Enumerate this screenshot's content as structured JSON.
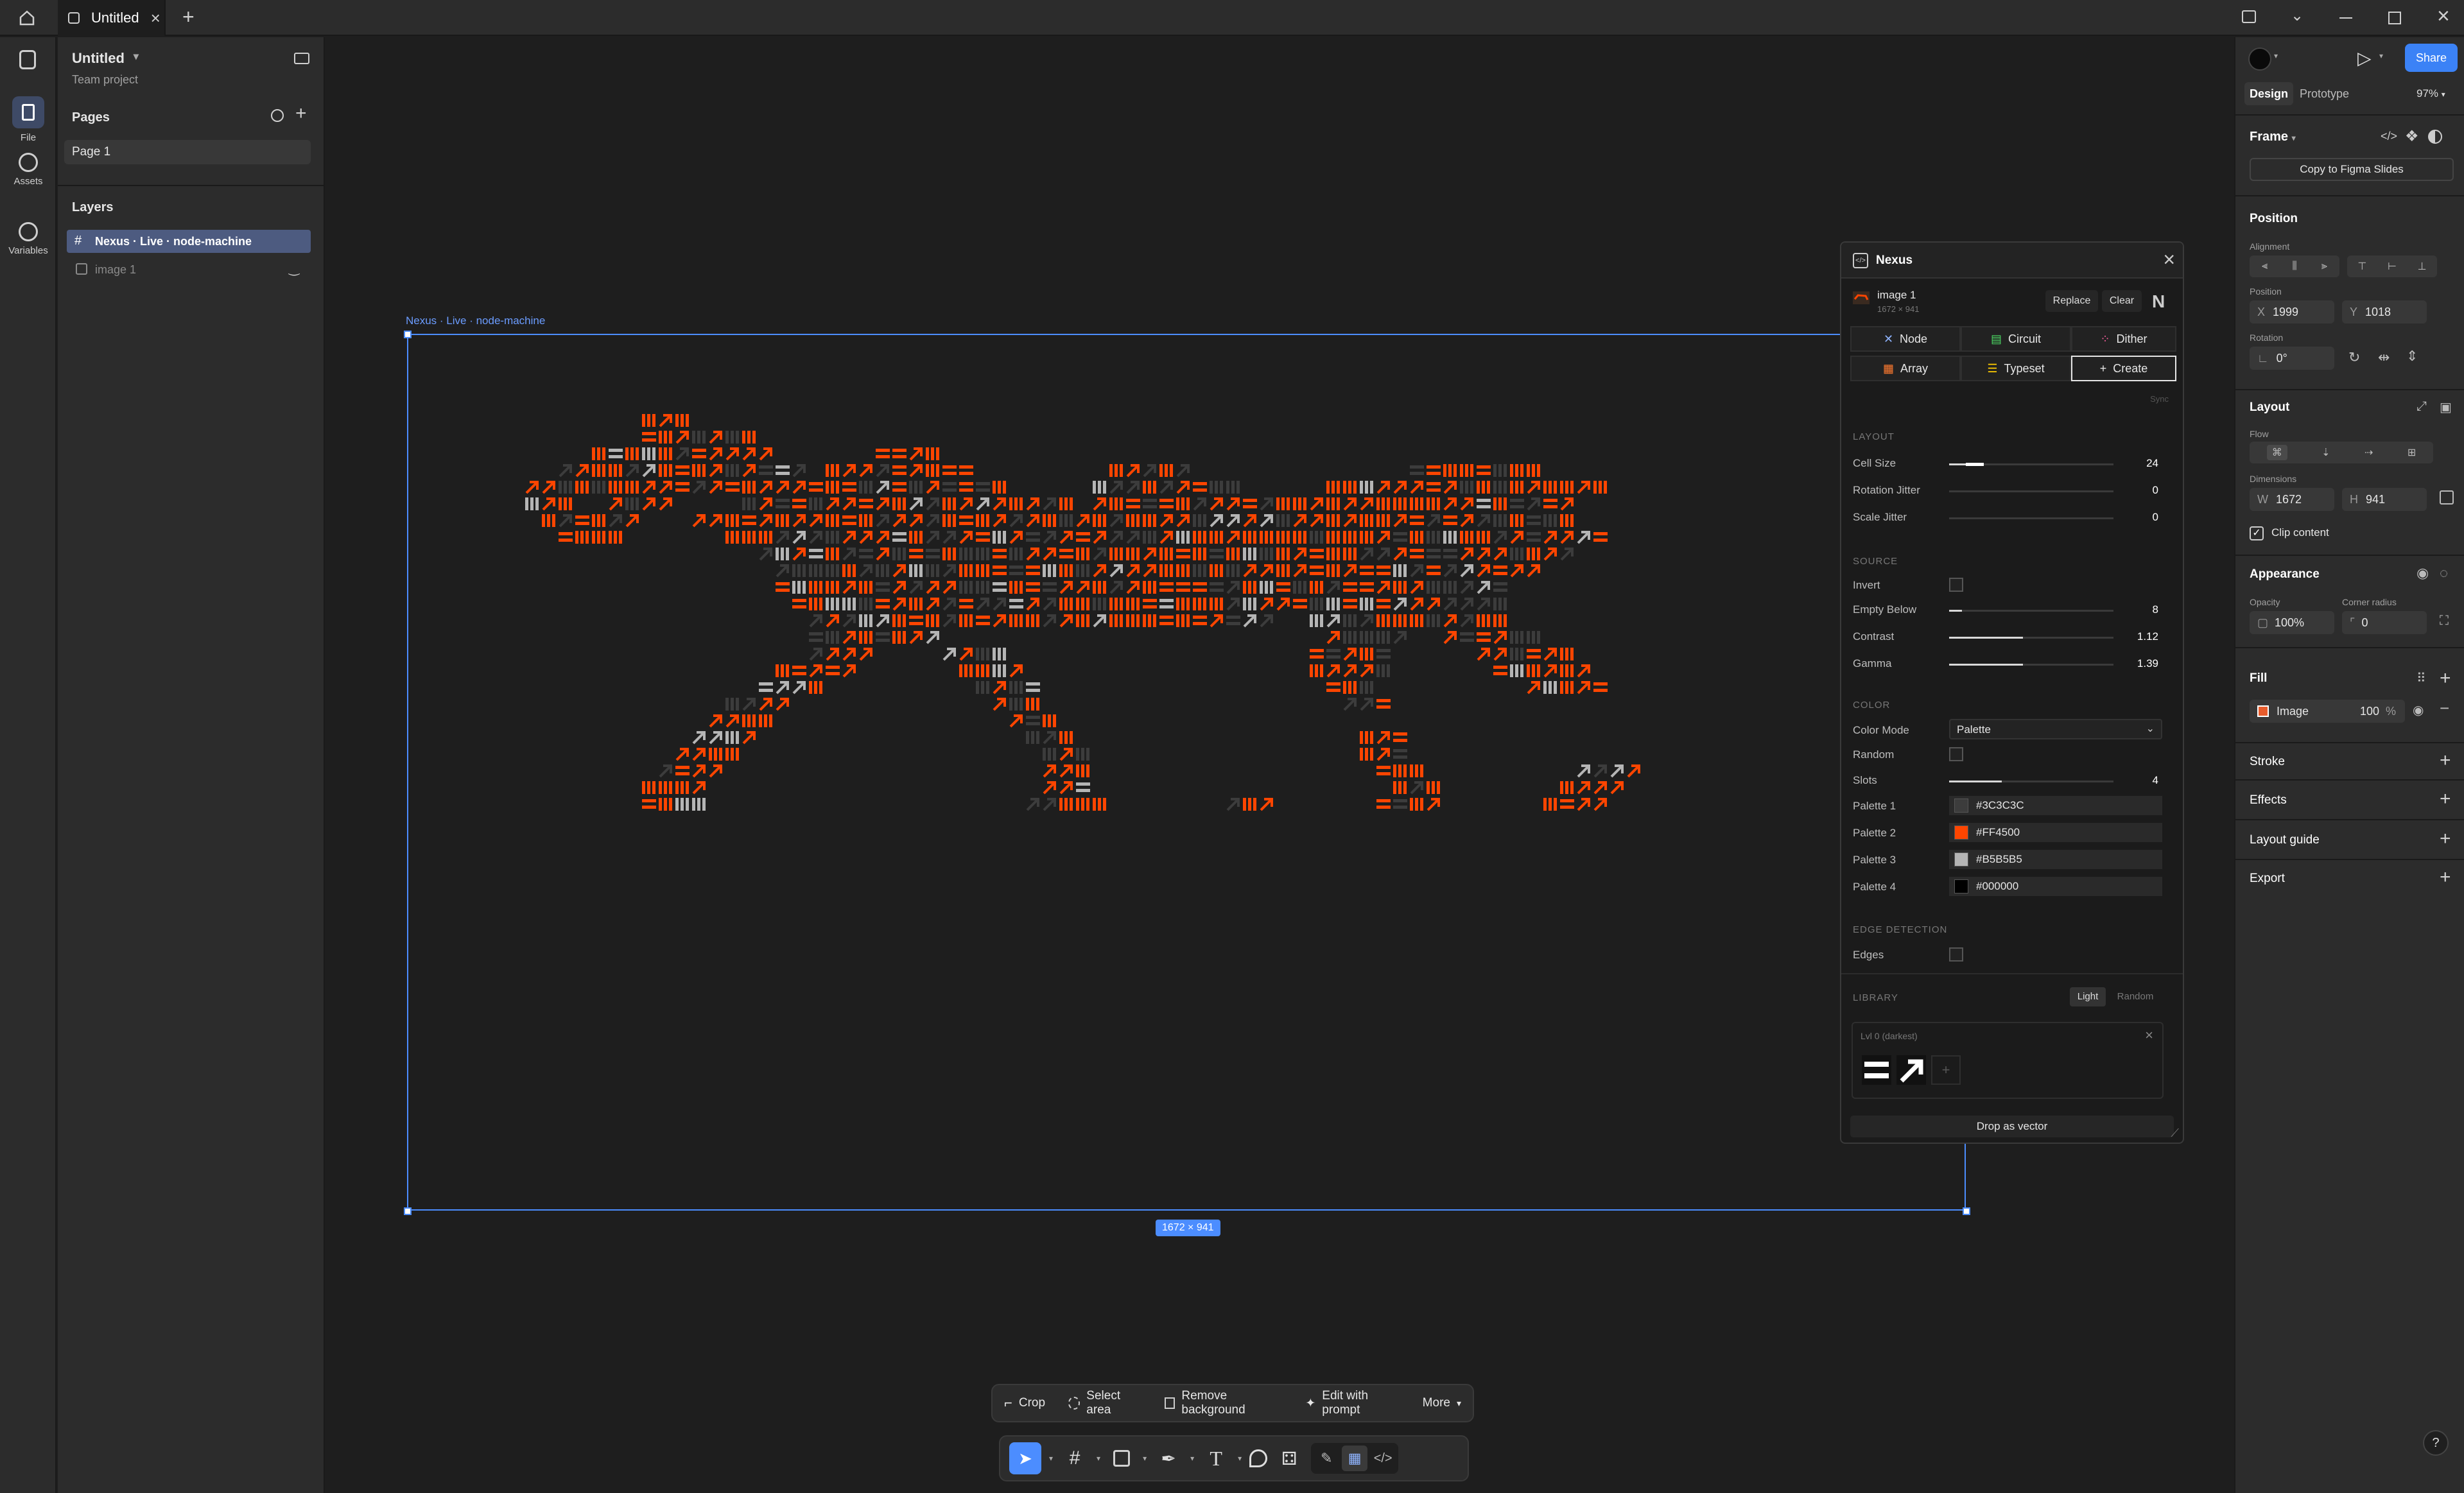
{
  "titlebar": {
    "tab_title": "Untitled",
    "window_controls": [
      "minimize-icon",
      "maximize-icon",
      "close-icon"
    ]
  },
  "rail": {
    "items": [
      {
        "label": "File",
        "icon": "file-icon"
      },
      {
        "label": "Assets",
        "icon": "assets-icon"
      },
      {
        "label": "Variables",
        "icon": "variables-icon"
      }
    ]
  },
  "left_panel": {
    "file_name": "Untitled",
    "team": "Team project",
    "pages_title": "Pages",
    "pages": [
      "Page 1"
    ],
    "layers_title": "Layers",
    "layers": [
      {
        "name": "Nexus · Live · node-machine",
        "selected": true,
        "icon": "frame-icon"
      },
      {
        "name": "image 1",
        "selected": false,
        "icon": "image-icon"
      }
    ]
  },
  "canvas": {
    "frame_label": "Nexus · Live · node-machine",
    "size_badge": "1672 × 941",
    "background": "#1e1e1e",
    "art_colors": {
      "orange": "#FF4500",
      "grey": "#3C3C3C",
      "light": "#B5B5B5"
    }
  },
  "plugin": {
    "title": "Nexus",
    "image_name": "image 1",
    "image_dims": "1672 × 941",
    "replace_label": "Replace",
    "clear_label": "Clear",
    "modes": [
      "Node",
      "Circuit",
      "Dither",
      "Array",
      "Typeset",
      "Create"
    ],
    "active_mode": "Create",
    "sync_label": "Sync",
    "layout": {
      "section": "LAYOUT",
      "rows": [
        {
          "label": "Cell Size",
          "value": "24",
          "level": 0.1
        },
        {
          "label": "Rotation Jitter",
          "value": "0",
          "level": 0
        },
        {
          "label": "Scale Jitter",
          "value": "0",
          "level": 0
        }
      ]
    },
    "source": {
      "section": "SOURCE",
      "invert_label": "Invert",
      "rows": [
        {
          "label": "Empty Below",
          "value": "8",
          "level": 0.08
        },
        {
          "label": "Contrast",
          "value": "1.12",
          "level": 0.45
        },
        {
          "label": "Gamma",
          "value": "1.39",
          "level": 0.45
        }
      ]
    },
    "color": {
      "section": "COLOR",
      "mode_label": "Color Mode",
      "mode_value": "Palette",
      "random_label": "Random",
      "slots_label": "Slots",
      "slots_value": "4",
      "slots_level": 0.32,
      "palettes": [
        {
          "label": "Palette 1",
          "hex": "#3C3C3C"
        },
        {
          "label": "Palette 2",
          "hex": "#FF4500"
        },
        {
          "label": "Palette 3",
          "hex": "#B5B5B5"
        },
        {
          "label": "Palette 4",
          "hex": "#000000"
        }
      ]
    },
    "edge": {
      "section": "EDGE DETECTION",
      "edges_label": "Edges"
    },
    "library": {
      "section": "LIBRARY",
      "light_label": "Light",
      "random_label": "Random",
      "level_title": "Lvl 0 (darkest)"
    },
    "drop_label": "Drop as vector"
  },
  "right_panel": {
    "tabs": [
      "Design",
      "Prototype"
    ],
    "zoom": "97%",
    "share_label": "Share",
    "frame_label": "Frame",
    "copy_slides_label": "Copy to Figma Slides",
    "position_title": "Position",
    "alignment_label": "Alignment",
    "position_label": "Position",
    "x": "1999",
    "y": "1018",
    "rotation_label": "Rotation",
    "rotation": "0°",
    "layout_title": "Layout",
    "flow_label": "Flow",
    "dimensions_label": "Dimensions",
    "w": "1672",
    "h": "941",
    "clip_label": "Clip content",
    "appearance_title": "Appearance",
    "opacity_label": "Opacity",
    "opacity": "100%",
    "radius_label": "Corner radius",
    "radius": "0",
    "fill_title": "Fill",
    "fill_type": "Image",
    "fill_opacity": "100",
    "fill_unit": "%",
    "stroke_title": "Stroke",
    "effects_title": "Effects",
    "layout_guide_title": "Layout guide",
    "export_title": "Export"
  },
  "image_toolbar": {
    "items": [
      "Crop",
      "Select area",
      "Remove background",
      "Edit with prompt",
      "More"
    ]
  },
  "main_toolbar": {
    "tools": [
      "move-tool-icon",
      "frame-tool-icon",
      "rectangle-tool-icon",
      "pen-tool-icon",
      "text-tool-icon",
      "comment-tool-icon",
      "actions-icon",
      "draw-mode-icon",
      "design-mode-icon",
      "dev-mode-icon"
    ]
  },
  "help_label": "?"
}
